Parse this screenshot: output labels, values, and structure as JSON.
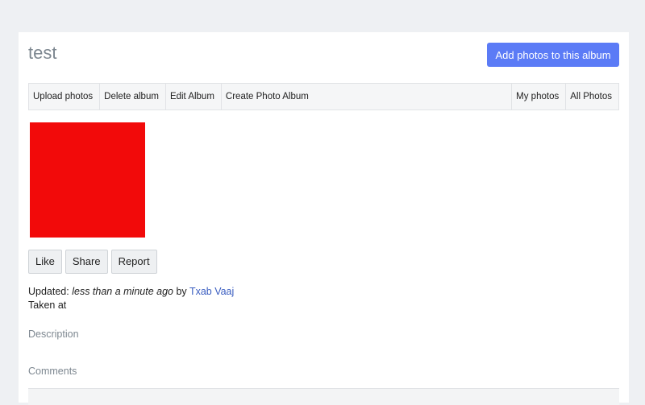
{
  "album": {
    "title": "test",
    "add_photos_label": "Add photos to this album"
  },
  "toolbar": {
    "items": [
      "Upload photos",
      "Delete album",
      "Edit Album",
      "Create Photo Album"
    ],
    "right_items": [
      "My photos",
      "All Photos"
    ]
  },
  "photo": {
    "color": "#f20a0a"
  },
  "actions": {
    "like": "Like",
    "share": "Share",
    "report": "Report"
  },
  "meta": {
    "updated_label": "Updated:",
    "updated_value": "less than a minute ago",
    "by_label": "by",
    "author": "Txab Vaaj",
    "taken_label": "Taken at"
  },
  "sections": {
    "description": "Description",
    "comments": "Comments"
  },
  "colors": {
    "accent": "#5b7bf6",
    "link": "#3a5dc0",
    "muted": "#7d8790"
  }
}
